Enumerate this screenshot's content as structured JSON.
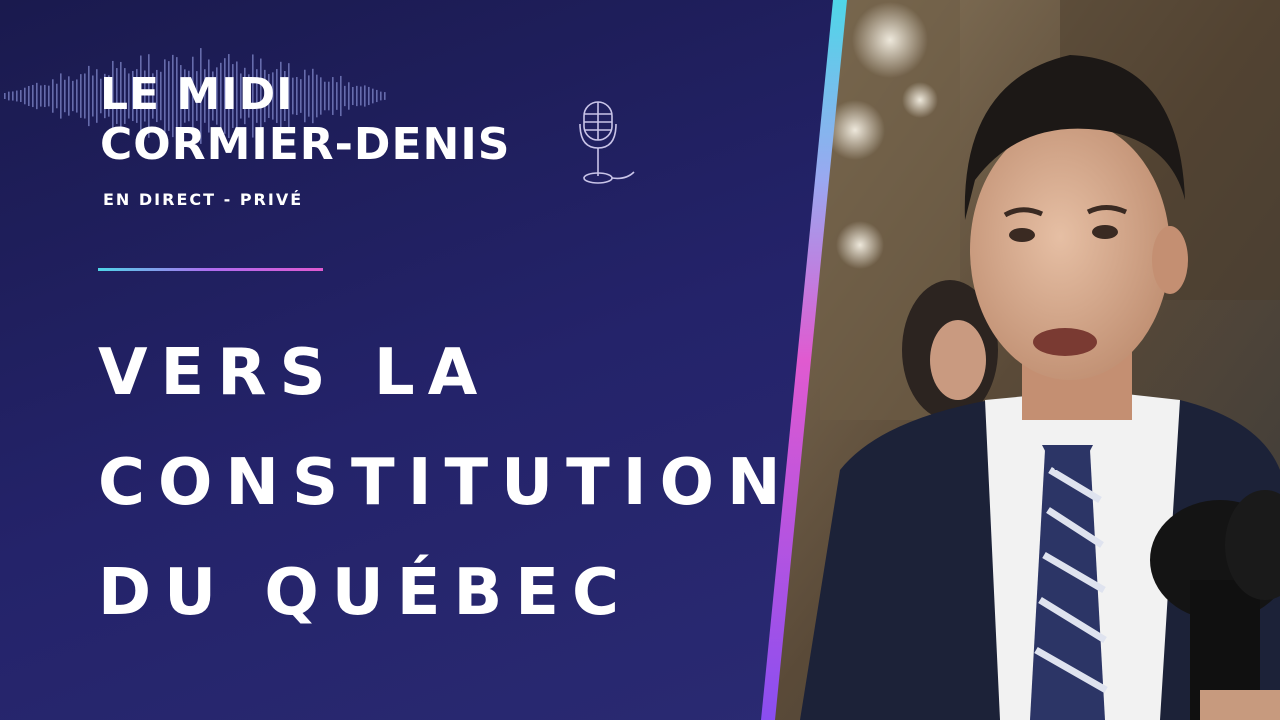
{
  "show": {
    "title_line1": "LE MIDI",
    "title_line2": "CORMIER-DENIS",
    "subtitle": "EN DIRECT - PRIVÉ"
  },
  "headline": {
    "line1": "VERS LA",
    "line2": "CONSTITUTION",
    "line3": "DU QUÉBEC"
  },
  "colors": {
    "background": "#1e2060",
    "accent_cyan": "#4fd6e8",
    "accent_purple": "#b06cf0",
    "accent_pink": "#e05ad0",
    "text": "#ffffff"
  },
  "icons": [
    "waveform-graphic",
    "microphone-icon"
  ]
}
